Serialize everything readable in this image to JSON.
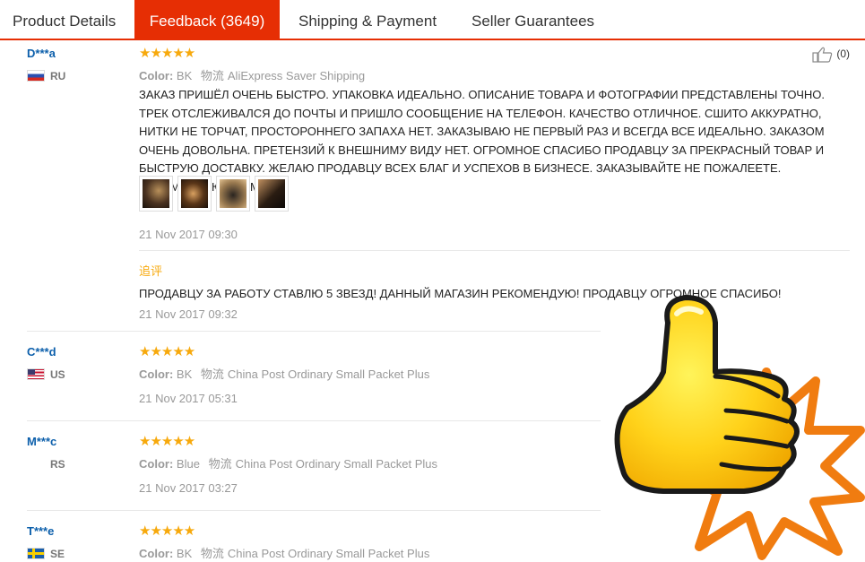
{
  "tabs": [
    {
      "label": "Product Details",
      "active": false
    },
    {
      "label": "Feedback (3649)",
      "active": true
    },
    {
      "label": "Shipping & Payment",
      "active": false
    },
    {
      "label": "Seller Guarantees",
      "active": false
    }
  ],
  "reviews": [
    {
      "user": "D***a",
      "country": "RU",
      "stars": "★★★★★",
      "rating": 5,
      "color_label": "Color:",
      "color_value": "BK",
      "shipping_label": "物流",
      "shipping_value": "AliExpress Saver Shipping",
      "text": "ЗАКАЗ ПРИШЁЛ ОЧЕНЬ БЫСТРО. УПАКОВКА ИДЕАЛЬНО. ОПИСАНИЕ ТОВАРА И ФОТОГРАФИИ ПРЕДСТАВЛЕНЫ ТОЧНО. ТРЕК ОТСЛЕЖИВАЛСЯ ДО ПОЧТЫ И ПРИШЛО СООБЩЕНИЕ НА ТЕЛЕФОН. КАЧЕСТВО ОТЛИЧНОЕ. СШИТО АККУРАТНО, НИТКИ НЕ ТОРЧАТ, ПРОСТОРОННЕГО ЗАПАХА НЕТ. ЗАКАЗЫВАЮ НЕ ПЕРВЫЙ РАЗ И ВСЕГДА ВСЕ ИДЕАЛЬНО. ЗАКАЗОМ ОЧЕНЬ ДОВОЛЬНА. ПРЕТЕНЗИЙ К ВНЕШНИМУ ВИДУ НЕТ. ОГРОМНОЕ СПАСИБО ПРОДАВЦУ ЗА ПРЕКРАСНЫЙ ТОВАР И БЫСТРУЮ ДОСТАВКУ. ЖЕЛАЮ ПРОДАВЦУ ВСЕХ БЛАГ И УСПЕХОВ В БИЗНЕСЕ. ЗАКАЗЫВАЙТЕ НЕ ПОЖАЛЕЕТЕ. РЕКОМЕНДУЮ ВСЕМ!",
      "date": "21 Nov 2017 09:30",
      "likes": "(0)",
      "append_label": "追评",
      "append_text": "ПРОДАВЦУ ЗА РАБОТУ СТАВЛЮ 5 ЗВЕЗД! ДАННЫЙ МАГАЗИН РЕКОМЕНДУЮ! ПРОДАВЦУ ОГРОМНОЕ СПАСИБО!",
      "append_date": "21 Nov 2017 09:32"
    },
    {
      "user": "C***d",
      "country": "US",
      "stars": "★★★★★",
      "rating": 5,
      "color_label": "Color:",
      "color_value": "BK",
      "shipping_label": "物流",
      "shipping_value": "China Post Ordinary Small Packet Plus",
      "date": "21 Nov 2017 05:31"
    },
    {
      "user": "M***c",
      "country": "RS",
      "stars": "★★★★★",
      "rating": 5,
      "color_label": "Color:",
      "color_value": "Blue",
      "shipping_label": "物流",
      "shipping_value": "China Post Ordinary Small Packet Plus",
      "date": "21 Nov 2017 03:27"
    },
    {
      "user": "T***e",
      "country": "SE",
      "stars": "★★★★★",
      "rating": 5,
      "color_label": "Color:",
      "color_value": "BK",
      "shipping_label": "物流",
      "shipping_value": "China Post Ordinary Small Packet Plus"
    }
  ],
  "colors": {
    "accent": "#e62e04",
    "star": "#f7a90c",
    "username": "#0c5fab"
  }
}
